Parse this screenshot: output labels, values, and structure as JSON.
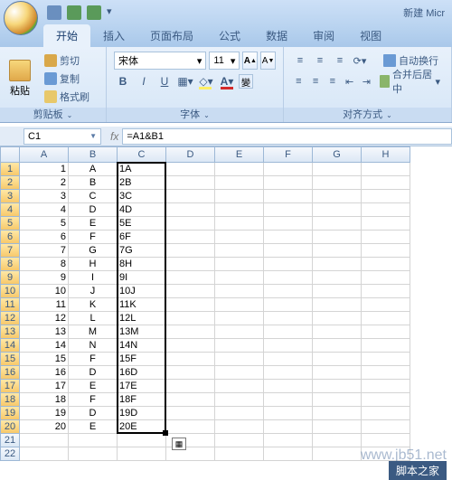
{
  "title": "新建 Micr",
  "tabs": [
    "开始",
    "插入",
    "页面布局",
    "公式",
    "数据",
    "审阅",
    "视图"
  ],
  "active_tab": 0,
  "clipboard": {
    "paste": "粘贴",
    "cut": "剪切",
    "copy": "复制",
    "fmt": "格式刷",
    "group": "剪贴板"
  },
  "font": {
    "name": "宋体",
    "size": "11",
    "inc": "A",
    "dec": "A",
    "bold": "B",
    "italic": "I",
    "underline": "U",
    "group": "字体",
    "wen": "變"
  },
  "align": {
    "wrap": "自动换行",
    "merge": "合并后居中",
    "group": "对齐方式"
  },
  "namebox": "C1",
  "formula": "=A1&B1",
  "cols": [
    "A",
    "B",
    "C",
    "D",
    "E",
    "F",
    "G",
    "H"
  ],
  "rows": [
    {
      "n": "1",
      "a": "1",
      "b": "A",
      "c": "1A"
    },
    {
      "n": "2",
      "a": "2",
      "b": "B",
      "c": "2B"
    },
    {
      "n": "3",
      "a": "3",
      "b": "C",
      "c": "3C"
    },
    {
      "n": "4",
      "a": "4",
      "b": "D",
      "c": "4D"
    },
    {
      "n": "5",
      "a": "5",
      "b": "E",
      "c": "5E"
    },
    {
      "n": "6",
      "a": "6",
      "b": "F",
      "c": "6F"
    },
    {
      "n": "7",
      "a": "7",
      "b": "G",
      "c": "7G"
    },
    {
      "n": "8",
      "a": "8",
      "b": "H",
      "c": "8H"
    },
    {
      "n": "9",
      "a": "9",
      "b": "I",
      "c": "9I"
    },
    {
      "n": "10",
      "a": "10",
      "b": "J",
      "c": "10J"
    },
    {
      "n": "11",
      "a": "11",
      "b": "K",
      "c": "11K"
    },
    {
      "n": "12",
      "a": "12",
      "b": "L",
      "c": "12L"
    },
    {
      "n": "13",
      "a": "13",
      "b": "M",
      "c": "13M"
    },
    {
      "n": "14",
      "a": "14",
      "b": "N",
      "c": "14N"
    },
    {
      "n": "15",
      "a": "15",
      "b": "F",
      "c": "15F"
    },
    {
      "n": "16",
      "a": "16",
      "b": "D",
      "c": "16D"
    },
    {
      "n": "17",
      "a": "17",
      "b": "E",
      "c": "17E"
    },
    {
      "n": "18",
      "a": "18",
      "b": "F",
      "c": "18F"
    },
    {
      "n": "19",
      "a": "19",
      "b": "D",
      "c": "19D"
    },
    {
      "n": "20",
      "a": "20",
      "b": "E",
      "c": "20E"
    }
  ],
  "empty_rows": [
    "21",
    "22"
  ],
  "selection": {
    "col": "C",
    "row_start": 1,
    "row_end": 20
  },
  "watermark": "www.jb51.net",
  "footer": "脚本之家"
}
